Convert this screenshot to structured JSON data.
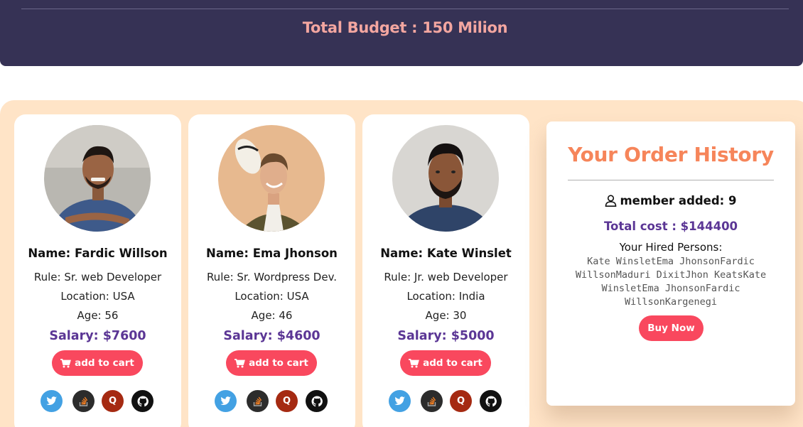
{
  "header": {
    "budget": "Total Budget : 150 Milion"
  },
  "persons": [
    {
      "name": "Name: Fardic Willson",
      "role": "Rule: Sr. web Developer",
      "location": "Location: USA",
      "age": "Age: 56",
      "salary": "Salary: $7600",
      "button": "add to cart"
    },
    {
      "name": "Name: Ema Jhonson",
      "role": "Rule: Sr. Wordpress Dev.",
      "location": "Location: USA",
      "age": "Age: 46",
      "salary": "Salary: $4600",
      "button": "add to cart"
    },
    {
      "name": "Name: Kate Winslet",
      "role": "Rule: Jr. web Developer",
      "location": "Location: India",
      "age": "Age: 30",
      "salary": "Salary: $5000",
      "button": "add to cart"
    }
  ],
  "socials": [
    "twitter-icon",
    "stackoverflow-icon",
    "quora-icon",
    "github-icon"
  ],
  "order": {
    "title": "Your Order History",
    "members": "member added: 9",
    "total": "Total cost : $144400",
    "hired_label": "Your Hired Persons:",
    "hired_list": "Kate WinsletEma JhonsonFardic WillsonMaduri DixitJhon KeatsKate WinsletEma JhonsonFardic WillsonKargenegi",
    "buy_button": "Buy Now"
  },
  "colors": {
    "header_bg": "#363255",
    "budget_text": "#f3a6a0",
    "section_bg": "#ffe4c7",
    "accent_button": "#f9485e",
    "salary_text": "#5b3695",
    "order_title": "#f6855a"
  }
}
